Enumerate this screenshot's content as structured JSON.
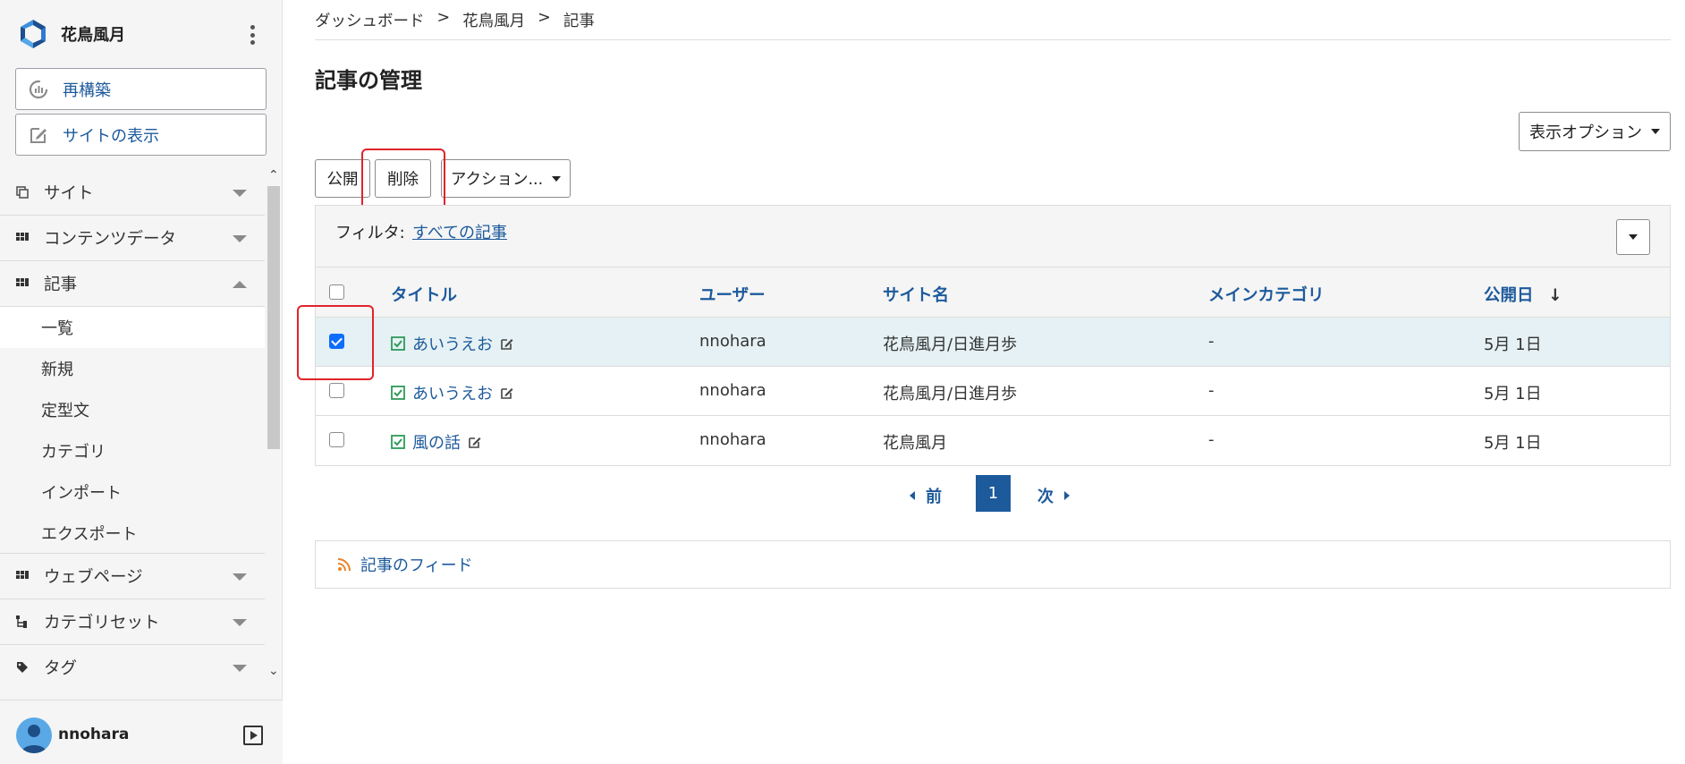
{
  "brand": {
    "name": "花鳥風月"
  },
  "sidebar": {
    "rebuild_label": "再構築",
    "view_site_label": "サイトの表示",
    "menu": [
      {
        "label": "サイト"
      },
      {
        "label": "コンテンツデータ"
      },
      {
        "label": "記事"
      }
    ],
    "submenu": [
      {
        "label": "一覧"
      },
      {
        "label": "新規"
      },
      {
        "label": "定型文"
      },
      {
        "label": "カテゴリ"
      },
      {
        "label": "インポート"
      },
      {
        "label": "エクスポート"
      }
    ],
    "menu_after": [
      {
        "label": "ウェブページ"
      },
      {
        "label": "カテゴリセット"
      },
      {
        "label": "タグ"
      }
    ],
    "user": "nnohara"
  },
  "breadcrumb": [
    {
      "label": "ダッシュボード"
    },
    {
      "label": ">"
    },
    {
      "label": "花鳥風月"
    },
    {
      "label": ">"
    },
    {
      "label": "記事"
    }
  ],
  "page_title": "記事の管理",
  "display_options_label": "表示オプション",
  "actions": {
    "publish": "公開",
    "delete": "削除",
    "more": "アクション..."
  },
  "filter": {
    "label": "フィルタ:",
    "value": "すべての記事"
  },
  "table": {
    "headers": [
      "タイトル",
      "ユーザー",
      "サイト名",
      "メインカテゴリ",
      "公開日"
    ],
    "sort_indicator": "↓",
    "rows": [
      {
        "title": "あいうえお",
        "user": "nnohara",
        "site": "花鳥風月/日進月歩",
        "category": "-",
        "date": "5月 1日",
        "checked": true
      },
      {
        "title": "あいうえお",
        "user": "nnohara",
        "site": "花鳥風月/日進月歩",
        "category": "-",
        "date": "5月 1日",
        "checked": false
      },
      {
        "title": "風の話",
        "user": "nnohara",
        "site": "花鳥風月",
        "category": "-",
        "date": "5月 1日",
        "checked": false
      }
    ]
  },
  "pagination": {
    "prev": "前",
    "current": "1",
    "next": "次"
  },
  "feed_label": "記事のフィード",
  "colors": {
    "accent": "#1d5a9c",
    "selected_row": "#e5f1f4",
    "highlight": "#e0242a",
    "check": "#0d6efd"
  }
}
